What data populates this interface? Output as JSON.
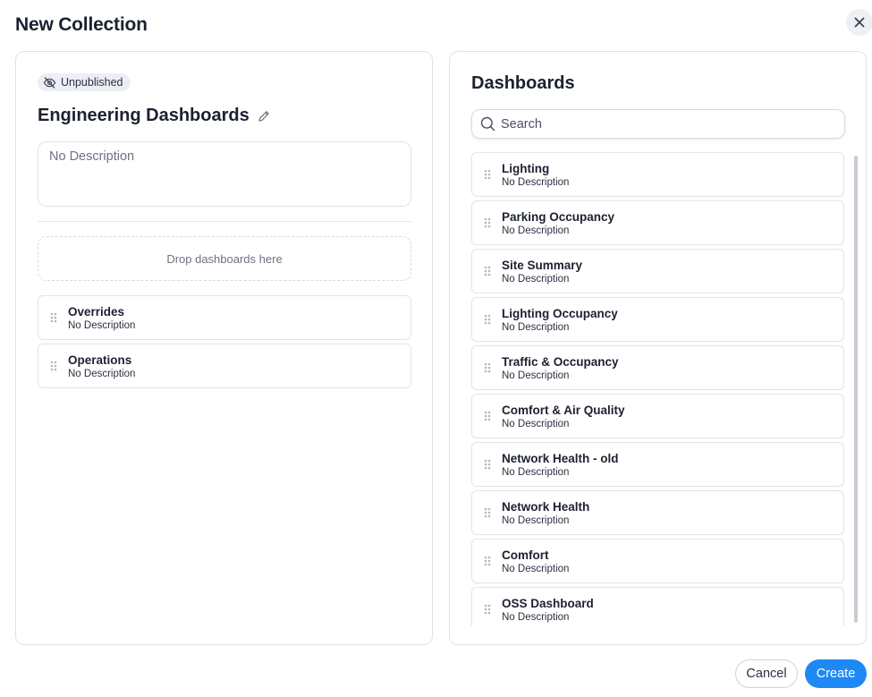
{
  "modal": {
    "title": "New Collection",
    "close_icon": "close-icon"
  },
  "collection": {
    "status_badge": "Unpublished",
    "status_icon": "eye-off-icon",
    "name": "Engineering Dashboards",
    "edit_icon": "pencil-icon",
    "description_placeholder": "No Description",
    "drop_zone_text": "Drop dashboards here",
    "items": [
      {
        "title": "Overrides",
        "description": "No Description"
      },
      {
        "title": "Operations",
        "description": "No Description"
      }
    ]
  },
  "dashboards": {
    "heading": "Dashboards",
    "search_placeholder": "Search",
    "search_icon": "search-icon",
    "items": [
      {
        "title": "Lighting",
        "description": "No Description"
      },
      {
        "title": "Parking Occupancy",
        "description": "No Description"
      },
      {
        "title": "Site Summary",
        "description": "No Description"
      },
      {
        "title": "Lighting Occupancy",
        "description": "No Description"
      },
      {
        "title": "Traffic & Occupancy",
        "description": "No Description"
      },
      {
        "title": "Comfort & Air Quality",
        "description": "No Description"
      },
      {
        "title": "Network Health - old",
        "description": "No Description"
      },
      {
        "title": "Network Health",
        "description": "No Description"
      },
      {
        "title": "Comfort",
        "description": "No Description"
      },
      {
        "title": "OSS Dashboard",
        "description": "No Description"
      }
    ]
  },
  "footer": {
    "cancel_label": "Cancel",
    "create_label": "Create"
  },
  "colors": {
    "primary": "#1e88f5",
    "border": "#dfe2e8",
    "text": "#1c2130",
    "muted": "#6b7280"
  }
}
